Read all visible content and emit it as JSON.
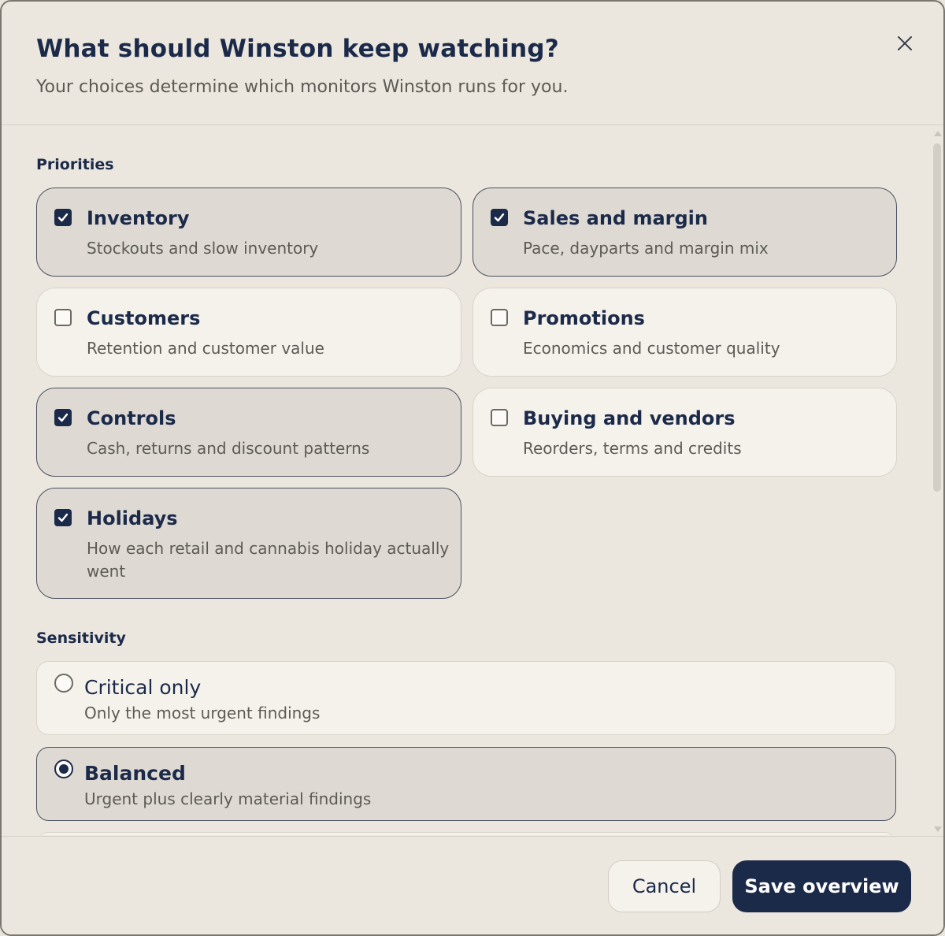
{
  "dialog": {
    "title": "What should Winston keep watching?",
    "subtitle": "Your choices determine which monitors Winston runs for you."
  },
  "priorities": {
    "label": "Priorities",
    "items": [
      {
        "title": "Inventory",
        "description": "Stockouts and slow inventory",
        "checked": true
      },
      {
        "title": "Sales and margin",
        "description": "Pace, dayparts and margin mix",
        "checked": true
      },
      {
        "title": "Customers",
        "description": "Retention and customer value",
        "checked": false
      },
      {
        "title": "Promotions",
        "description": "Economics and customer quality",
        "checked": false
      },
      {
        "title": "Controls",
        "description": "Cash, returns and discount patterns",
        "checked": true
      },
      {
        "title": "Buying and vendors",
        "description": "Reorders, terms and credits",
        "checked": false
      },
      {
        "title": "Holidays",
        "description": "How each retail and cannabis holiday actually went",
        "checked": true
      }
    ]
  },
  "sensitivity": {
    "label": "Sensitivity",
    "options": [
      {
        "title": "Critical only",
        "description": "Only the most urgent findings",
        "selected": false
      },
      {
        "title": "Balanced",
        "description": "Urgent plus clearly material findings",
        "selected": true
      }
    ]
  },
  "footer": {
    "cancel_label": "Cancel",
    "save_label": "Save overview"
  },
  "icons": {
    "close": "close-icon",
    "checkbox": "checkmark-icon"
  },
  "colors": {
    "accent": "#1c2a4a",
    "background": "#ebe7de",
    "card": "#f5f2ec",
    "card_checked": "#dedad3"
  }
}
